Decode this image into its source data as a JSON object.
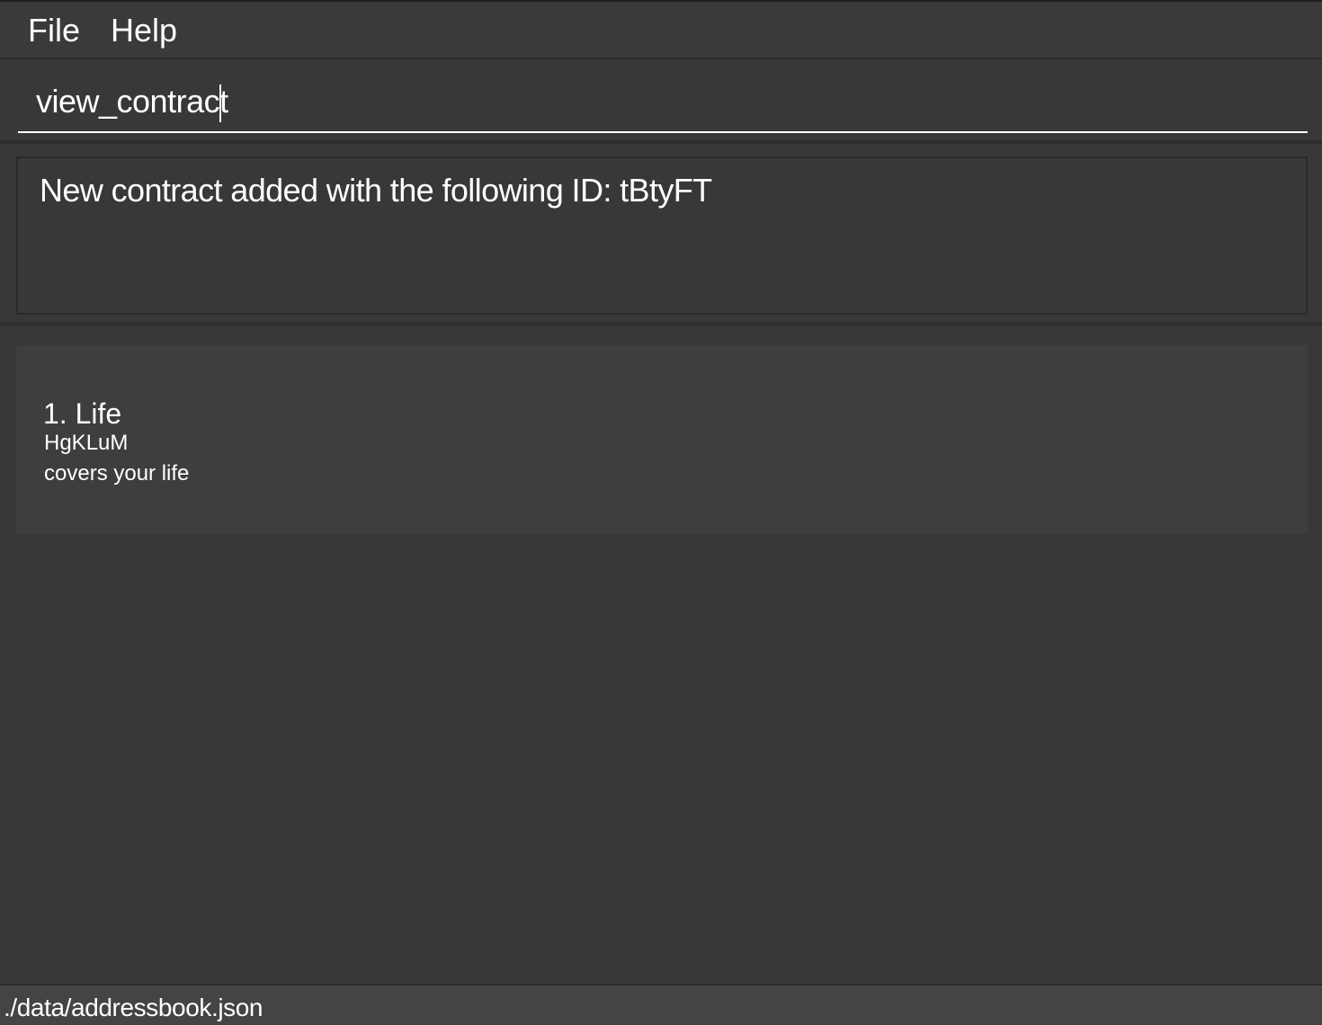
{
  "menu": {
    "items": [
      {
        "label": "File"
      },
      {
        "label": "Help"
      }
    ]
  },
  "command": {
    "value": "view_contract"
  },
  "result": {
    "message": "New contract added with the following ID: tBtyFT"
  },
  "contracts": [
    {
      "title": "1. Life",
      "id": "HgKLuM",
      "description": "covers your life"
    }
  ],
  "status": {
    "path": "./data/addressbook.json"
  },
  "colors": {
    "background": "#383838",
    "card": "#3c3e40",
    "statusbar": "#444444",
    "text": "#ffffff"
  }
}
